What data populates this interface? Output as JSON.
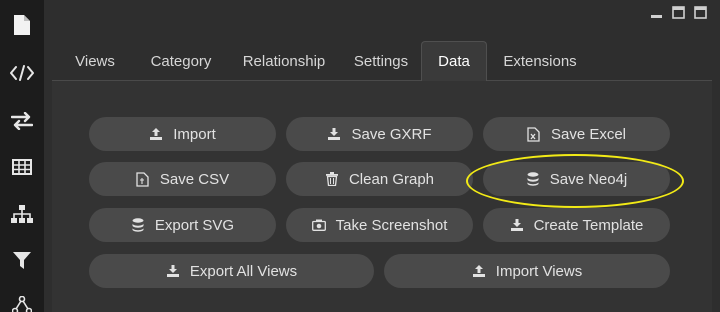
{
  "sidebar": {
    "items": [
      {
        "name": "sidebar-item-file",
        "icon": "file-icon"
      },
      {
        "name": "sidebar-item-code",
        "icon": "code-icon"
      },
      {
        "name": "sidebar-item-transfer",
        "icon": "transfer-arrows-icon"
      },
      {
        "name": "sidebar-item-table",
        "icon": "table-icon"
      },
      {
        "name": "sidebar-item-hierarchy",
        "icon": "hierarchy-icon"
      },
      {
        "name": "sidebar-item-filter",
        "icon": "filter-icon"
      },
      {
        "name": "sidebar-item-network",
        "icon": "network-icon"
      }
    ]
  },
  "window_controls": [
    "minimize-icon",
    "maximize-icon",
    "close-icon"
  ],
  "tabs": [
    {
      "label": "Views",
      "active": false
    },
    {
      "label": "Category",
      "active": false
    },
    {
      "label": "Relationship",
      "active": false
    },
    {
      "label": "Settings",
      "active": false
    },
    {
      "label": "Data",
      "active": true
    },
    {
      "label": "Extensions",
      "active": false
    }
  ],
  "buttons": {
    "import": {
      "label": "Import",
      "icon": "upload-icon"
    },
    "save_gxrf": {
      "label": "Save GXRF",
      "icon": "download-icon"
    },
    "save_excel": {
      "label": "Save Excel",
      "icon": "excel-file-icon"
    },
    "save_csv": {
      "label": "Save CSV",
      "icon": "csv-file-icon"
    },
    "clean_graph": {
      "label": "Clean Graph",
      "icon": "trash-icon"
    },
    "save_neo4j": {
      "label": "Save Neo4j",
      "icon": "database-icon"
    },
    "export_svg": {
      "label": "Export SVG",
      "icon": "database-icon"
    },
    "take_screenshot": {
      "label": "Take Screenshot",
      "icon": "camera-icon"
    },
    "create_template": {
      "label": "Create Template",
      "icon": "download-icon"
    },
    "export_all_views": {
      "label": "Export All Views",
      "icon": "download-icon"
    },
    "import_views": {
      "label": "Import Views",
      "icon": "upload-icon"
    }
  },
  "colors": {
    "sidebar_bg": "#1c1c1c",
    "panel_bg": "#2e2e2e",
    "button_bg": "#4a4a4a",
    "highlight": "#f2ea16"
  }
}
